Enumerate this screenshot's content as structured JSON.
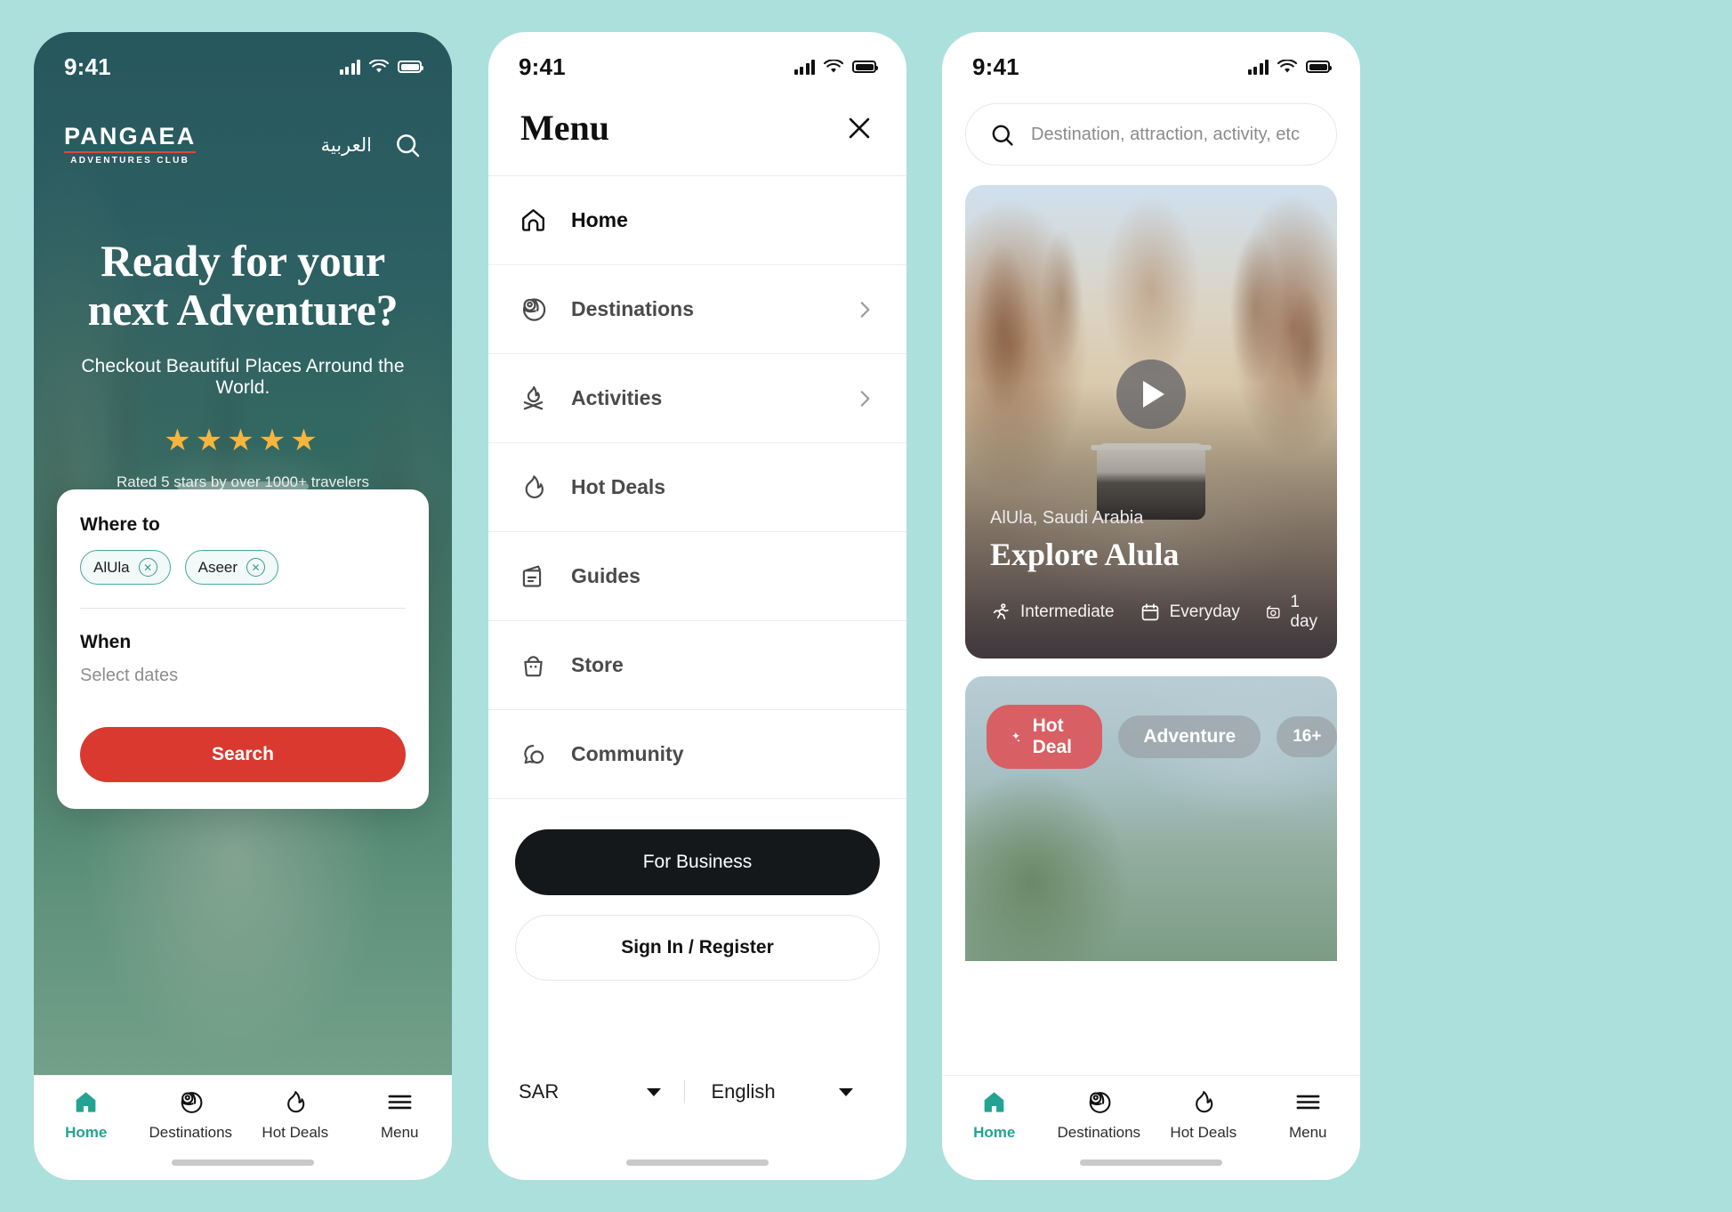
{
  "status_bar": {
    "time": "9:41"
  },
  "phone1": {
    "brand": {
      "word": "PANGAEA",
      "sub": "ADVENTURES CLUB"
    },
    "lang_toggle": "العربية",
    "hero": {
      "title_line1": "Ready for your",
      "title_line2": "next Adventure?",
      "subtitle": "Checkout Beautiful Places Arround the World.",
      "stars": "★★★★★",
      "rating_note": "Rated 5 stars by over 1000+ travelers"
    },
    "search_card": {
      "where_label": "Where to",
      "chips": [
        "AlUla",
        "Aseer"
      ],
      "when_label": "When",
      "dates_placeholder": "Select dates",
      "search_button": "Search"
    }
  },
  "phone2": {
    "title": "Menu",
    "items": [
      {
        "label": "Home",
        "icon": "home-icon",
        "chevron": false,
        "strong": true
      },
      {
        "label": "Destinations",
        "icon": "globe-pin-icon",
        "chevron": true,
        "strong": false
      },
      {
        "label": "Activities",
        "icon": "campfire-icon",
        "chevron": true,
        "strong": false
      },
      {
        "label": "Hot Deals",
        "icon": "flame-icon",
        "chevron": false,
        "strong": false
      },
      {
        "label": "Guides",
        "icon": "guide-book-icon",
        "chevron": false,
        "strong": false
      },
      {
        "label": "Store",
        "icon": "shopping-bag-icon",
        "chevron": false,
        "strong": false
      },
      {
        "label": "Community",
        "icon": "chat-bubbles-icon",
        "chevron": false,
        "strong": false
      }
    ],
    "business_button": "For Business",
    "signin_button": "Sign In / Register",
    "currency": "SAR",
    "language": "English"
  },
  "phone3": {
    "search_placeholder": "Destination, attraction, activity, etc",
    "card1": {
      "place": "AlUla, Saudi Arabia",
      "title": "Explore Alula",
      "meta": [
        {
          "label": "Intermediate",
          "icon": "runner-icon"
        },
        {
          "label": "Everyday",
          "icon": "calendar-icon"
        },
        {
          "label": "1 day",
          "icon": "duration-icon"
        }
      ]
    },
    "card2": {
      "badge_hot": "Hot Deal",
      "badge_category": "Adventure",
      "badge_age": "16+"
    }
  },
  "tabbar": {
    "items": [
      {
        "label": "Home",
        "icon": "home-icon",
        "active": true
      },
      {
        "label": "Destinations",
        "icon": "globe-pin-icon",
        "active": false
      },
      {
        "label": "Hot Deals",
        "icon": "flame-icon",
        "active": false
      },
      {
        "label": "Menu",
        "icon": "hamburger-icon",
        "active": false
      }
    ]
  },
  "colors": {
    "page_bg": "#ace0dc",
    "accent_teal": "#22a394",
    "accent_red": "#d9392f",
    "hot_deal": "#d85f63",
    "dark": "#15181a",
    "star": "#f5b53f"
  }
}
